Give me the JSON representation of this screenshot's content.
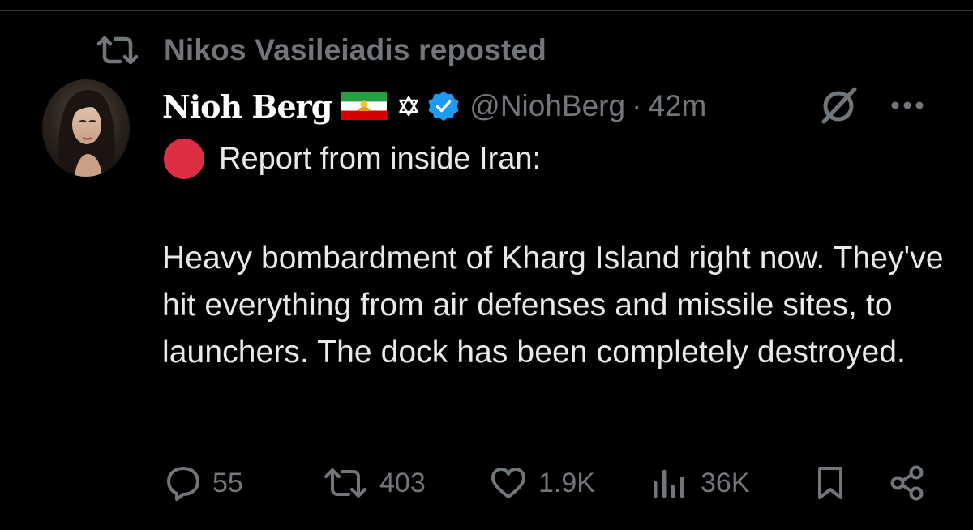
{
  "repost": {
    "text": "Nikos Vasileiadis reposted",
    "icon": "repost-icon"
  },
  "author": {
    "display_name": "Nioh Berg",
    "handle": "@NiohBerg",
    "separator": "·",
    "time": "42m",
    "badges": [
      "iran-lion-sun-flag-icon",
      "star-of-david-icon",
      "verified-badge-icon"
    ],
    "verified_color": "#1d9bf0"
  },
  "post": {
    "report_icon": "red-circle-icon",
    "report_color": "#dd2e44",
    "report_line": "Report from inside Iran:",
    "body": "Heavy bombardment of Kharg Island right now. They've hit everything from air defenses and missile sites, to launchers. The dock has been completely destroyed."
  },
  "actions": {
    "replies": "55",
    "reposts": "403",
    "likes": "1.9K",
    "views": "36K"
  },
  "colors": {
    "background": "#000000",
    "text_primary": "#e7e9ea",
    "text_secondary": "#71767b",
    "divider": "#2f3336"
  }
}
